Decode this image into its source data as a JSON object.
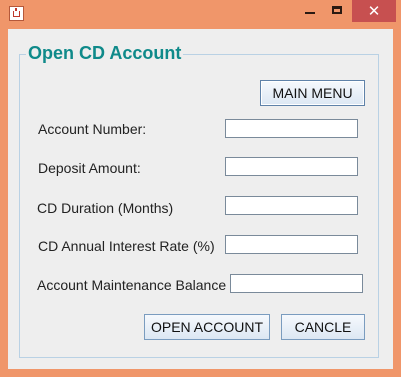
{
  "window": {
    "controls": {
      "minimize_icon": "minimize-icon",
      "maximize_icon": "maximize-icon",
      "close_icon": "close-icon",
      "close_glyph": "✕"
    }
  },
  "form": {
    "title": "Open CD Account",
    "main_menu_label": "MAIN MENU",
    "fields": [
      {
        "label": "Account Number:",
        "value": ""
      },
      {
        "label": "Deposit Amount:",
        "value": ""
      },
      {
        "label": "CD Duration (Months)",
        "value": ""
      },
      {
        "label": "CD Annual Interest Rate (%)",
        "value": ""
      },
      {
        "label": "Account Maintenance Balance",
        "value": ""
      }
    ],
    "open_account_label": "OPEN ACCOUNT",
    "cancel_label": "CANCLE"
  },
  "colors": {
    "title_bar": "#f0966a",
    "group_title": "#0f8a8a",
    "close_button": "#c75050"
  }
}
